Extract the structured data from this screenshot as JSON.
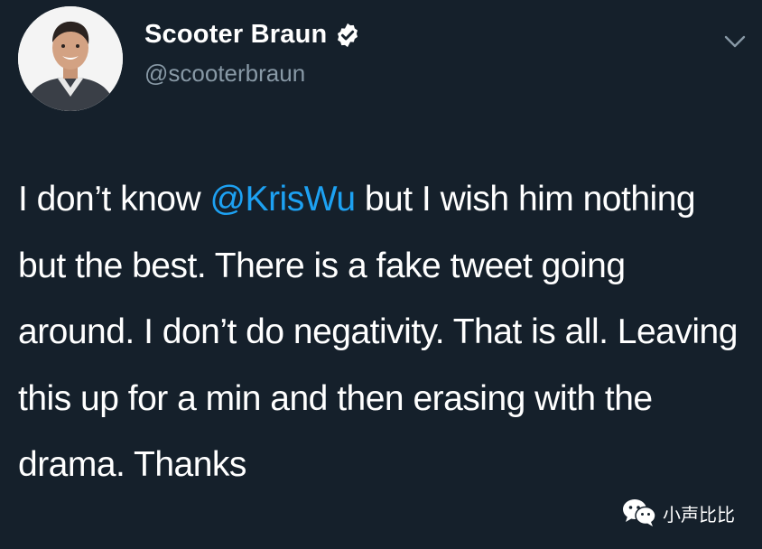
{
  "tweet": {
    "author": {
      "display_name": "Scooter Braun",
      "handle": "@scooterbraun",
      "verified": true,
      "avatar_icon": "profile-photo"
    },
    "body_segments": {
      "part1": "I don’t know ",
      "mention": "@KrisWu",
      "part2": " but I wish him nothing but the best. There is a fake tweet going around. I don’t do negativity. That is all. Leaving this up for a min and then erasing with the drama. Thanks"
    },
    "menu_icon": "chevron-down-icon"
  },
  "watermark": {
    "icon": "wechat-icon",
    "text": "小声比比"
  },
  "colors": {
    "background": "#15202b",
    "text": "#ffffff",
    "secondary_text": "#8899a6",
    "accent": "#1da1f2"
  }
}
